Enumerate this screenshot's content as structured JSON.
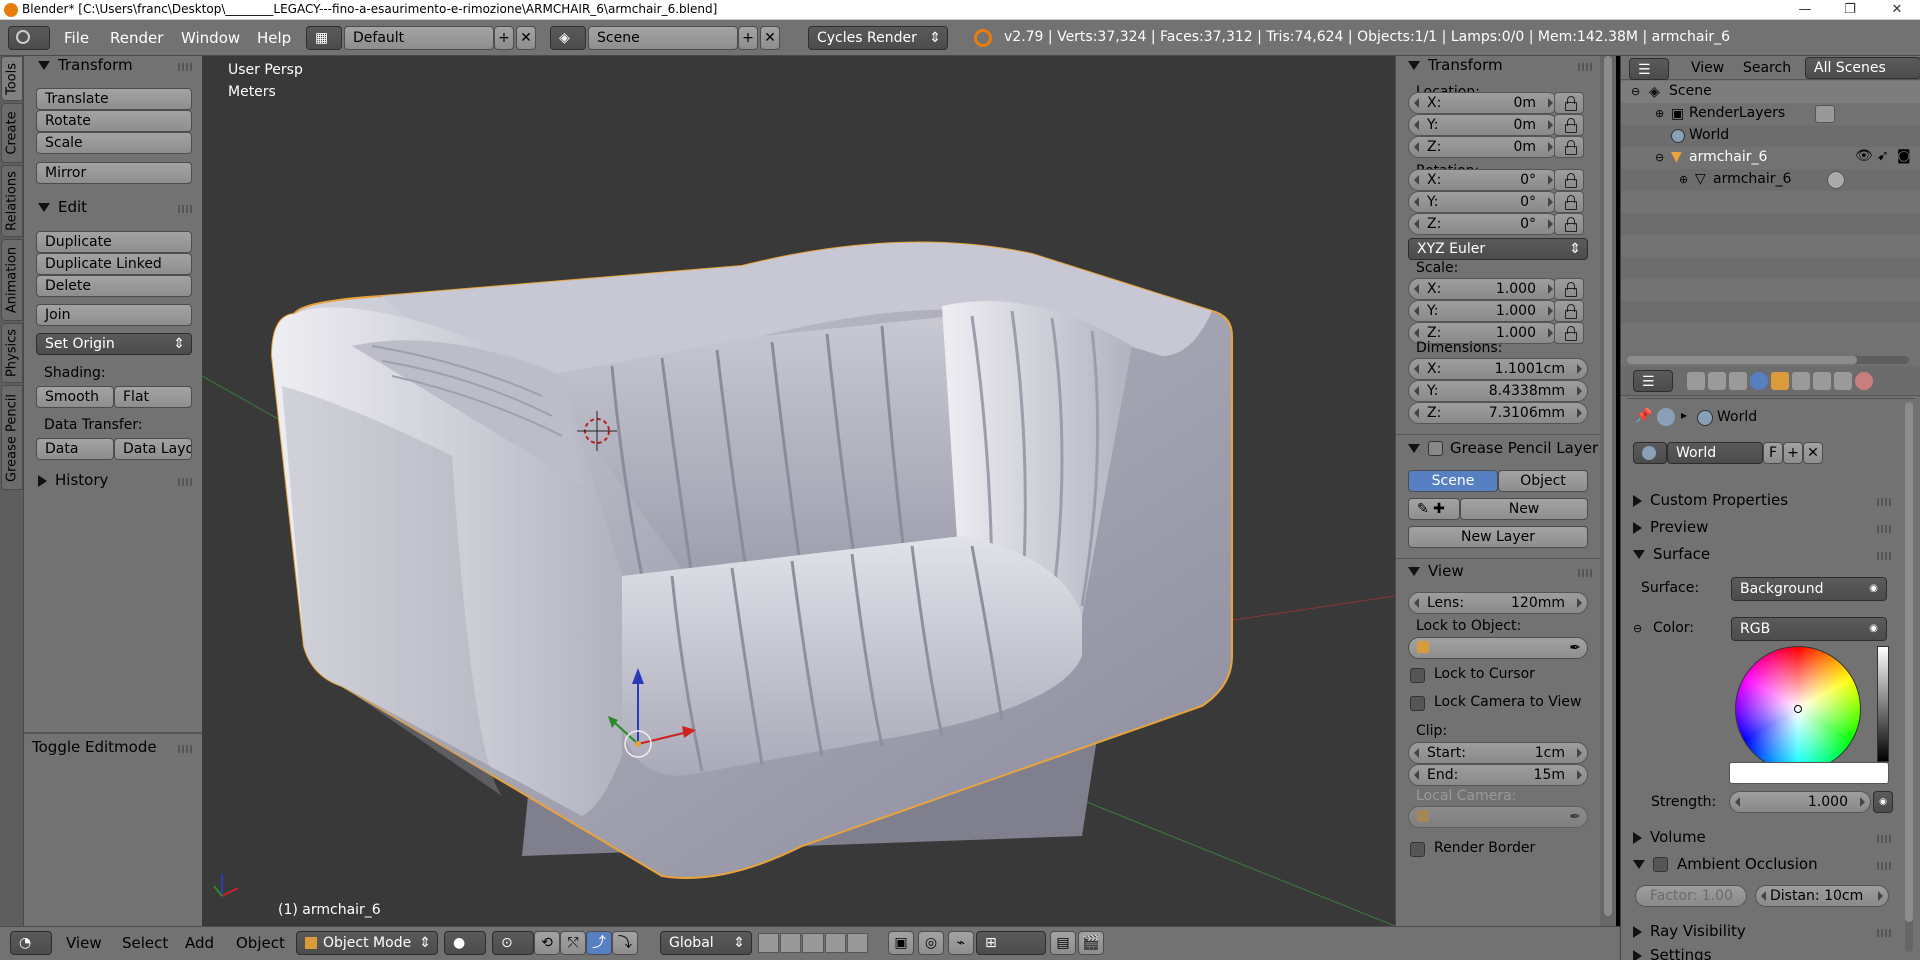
{
  "titlebar": {
    "title": "Blender* [C:\\Users\\franc\\Desktop\\________LEGACY---fino-a-esaurimento-e-rimozione\\ARMCHAIR_6\\armchair_6.blend]",
    "min": "—",
    "max": "❐",
    "close": "✕"
  },
  "infobar": {
    "menus": [
      "File",
      "Render",
      "Window",
      "Help"
    ],
    "layout": "Default",
    "scene": "Scene",
    "engine": "Cycles Render",
    "stats": "v2.79 | Verts:37,324 | Faces:37,312 | Tris:74,624 | Objects:1/1 | Lamps:0/0 | Mem:142.38M | armchair_6"
  },
  "toolshelf": {
    "tabs": [
      "Tools",
      "Create",
      "Relations",
      "Animation",
      "Physics",
      "Grease Pencil"
    ],
    "transform": {
      "header": "Transform",
      "buttons": [
        "Translate",
        "Rotate",
        "Scale",
        "Mirror"
      ]
    },
    "edit": {
      "header": "Edit",
      "buttons": [
        "Duplicate",
        "Duplicate Linked",
        "Delete",
        "Join"
      ],
      "set_origin": "Set Origin",
      "shading_label": "Shading:",
      "smooth": "Smooth",
      "flat": "Flat",
      "data_transfer_label": "Data Transfer:",
      "data": "Data",
      "data_layout": "Data Layo"
    },
    "history": "History",
    "toggle_editmode": "Toggle Editmode"
  },
  "viewport": {
    "view_name": "User Persp",
    "units": "Meters",
    "object_label": "(1) armchair_6"
  },
  "npanel": {
    "transform_header": "Transform",
    "location_label": "Location:",
    "location": [
      {
        "k": "X:",
        "v": "0m"
      },
      {
        "k": "Y:",
        "v": "0m"
      },
      {
        "k": "Z:",
        "v": "0m"
      }
    ],
    "rotation_label": "Rotation:",
    "rotation": [
      {
        "k": "X:",
        "v": "0°"
      },
      {
        "k": "Y:",
        "v": "0°"
      },
      {
        "k": "Z:",
        "v": "0°"
      }
    ],
    "rotation_mode": "XYZ Euler",
    "scale_label": "Scale:",
    "scale": [
      {
        "k": "X:",
        "v": "1.000"
      },
      {
        "k": "Y:",
        "v": "1.000"
      },
      {
        "k": "Z:",
        "v": "1.000"
      }
    ],
    "dimensions_label": "Dimensions:",
    "dimensions": [
      {
        "k": "X:",
        "v": "1.1001cm"
      },
      {
        "k": "Y:",
        "v": "8.4338mm"
      },
      {
        "k": "Z:",
        "v": "7.3106mm"
      }
    ],
    "grease_header": "Grease Pencil Layer",
    "scene_btn": "Scene",
    "object_btn": "Object",
    "new_btn": "New",
    "new_layer_btn": "New Layer",
    "view_header": "View",
    "lens": {
      "k": "Lens:",
      "v": "120mm"
    },
    "lock_to_object": "Lock to Object:",
    "lock_to_cursor": "Lock to Cursor",
    "lock_camera": "Lock Camera to View",
    "clip_label": "Clip:",
    "clip_start": {
      "k": "Start:",
      "v": "1cm"
    },
    "clip_end": {
      "k": "End:",
      "v": "15m"
    },
    "local_camera": "Local Camera:",
    "render_border": "Render Border"
  },
  "outliner": {
    "view": "View",
    "search": "Search",
    "filter": "All Scenes",
    "items": [
      "Scene",
      "RenderLayers",
      "World",
      "armchair_6",
      "armchair_6"
    ]
  },
  "props": {
    "context": "World",
    "world_name": "World",
    "fake_user": "F",
    "sections": {
      "custom": "Custom Properties",
      "preview": "Preview",
      "surface": "Surface",
      "volume": "Volume",
      "ao": "Ambient Occlusion",
      "ray": "Ray Visibility",
      "settings": "Settings"
    },
    "surface_label": "Surface:",
    "surface_value": "Background",
    "color_label": "Color:",
    "color_mode": "RGB",
    "strength_label": "Strength:",
    "strength_value": "1.000",
    "factor": "Factor:  1.00",
    "distance": "Distan: 10cm"
  },
  "bottombar": {
    "menus": [
      "View",
      "Select",
      "Add",
      "Object"
    ],
    "mode": "Object Mode",
    "orientation": "Global"
  },
  "colors": {
    "accent": "#5680c2",
    "panel": "#727272",
    "viewport": "#393939",
    "selection": "#e8a33d"
  }
}
